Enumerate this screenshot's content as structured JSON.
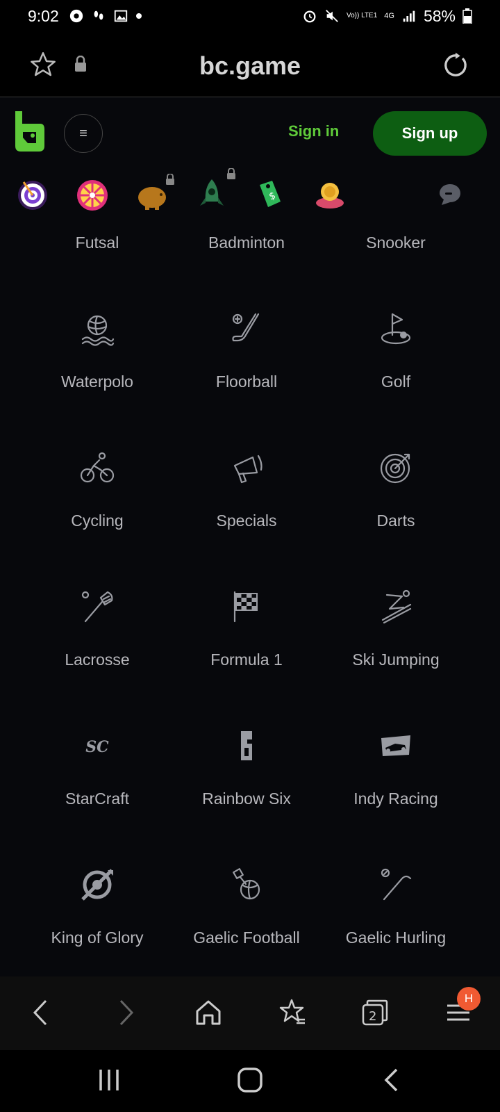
{
  "status_bar": {
    "time": "9:02",
    "battery_percent": "58%",
    "network_label": "4G",
    "volte_label": "Vo)) LTE1"
  },
  "browser": {
    "domain": "bc.game",
    "tab_count": "2",
    "profile_badge": "H"
  },
  "header": {
    "sign_in": "Sign in",
    "sign_up": "Sign up",
    "menu_glyph": "≡"
  },
  "sports": [
    {
      "label": "Futsal",
      "icon": "futsal-icon"
    },
    {
      "label": "Badminton",
      "icon": "badminton-icon"
    },
    {
      "label": "Snooker",
      "icon": "snooker-icon"
    },
    {
      "label": "Waterpolo",
      "icon": "waterpolo-icon"
    },
    {
      "label": "Floorball",
      "icon": "floorball-icon"
    },
    {
      "label": "Golf",
      "icon": "golf-icon"
    },
    {
      "label": "Cycling",
      "icon": "cycling-icon"
    },
    {
      "label": "Specials",
      "icon": "megaphone-icon"
    },
    {
      "label": "Darts",
      "icon": "darts-icon"
    },
    {
      "label": "Lacrosse",
      "icon": "lacrosse-icon"
    },
    {
      "label": "Formula 1",
      "icon": "checkered-flag-icon"
    },
    {
      "label": "Ski Jumping",
      "icon": "ski-jumping-icon"
    },
    {
      "label": "StarCraft",
      "icon": "starcraft-icon"
    },
    {
      "label": "Rainbow Six",
      "icon": "rainbow-six-icon"
    },
    {
      "label": "Indy Racing",
      "icon": "indy-racing-icon"
    },
    {
      "label": "King of Glory",
      "icon": "king-of-glory-icon"
    },
    {
      "label": "Gaelic Football",
      "icon": "gaelic-football-icon"
    },
    {
      "label": "Gaelic Hurling",
      "icon": "gaelic-hurling-icon"
    }
  ],
  "colors": {
    "brand_green": "#5fca3a",
    "signup_bg": "#0d5e12",
    "background": "#07080c",
    "label_gray": "#b8b8bd",
    "badge_orange": "#f05a32"
  }
}
